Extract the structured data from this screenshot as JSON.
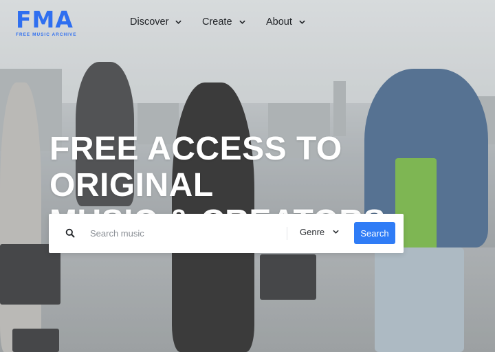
{
  "brand": {
    "logo_text": "FMA",
    "tagline": "FREE MUSIC ARCHIVE",
    "accent_color": "#2f6ff0"
  },
  "nav": {
    "items": [
      {
        "label": "Discover",
        "icon": "chevron-down-icon"
      },
      {
        "label": "Create",
        "icon": "chevron-down-icon"
      },
      {
        "label": "About",
        "icon": "chevron-down-icon"
      }
    ]
  },
  "hero": {
    "title_line1": "FREE ACCESS TO ORIGINAL",
    "title_line2": "MUSIC & CREATORS"
  },
  "search": {
    "icon": "search-icon",
    "placeholder": "Search music",
    "value": "",
    "genre_label": "Genre",
    "button_label": "Search",
    "button_color": "#2f7cf6"
  }
}
